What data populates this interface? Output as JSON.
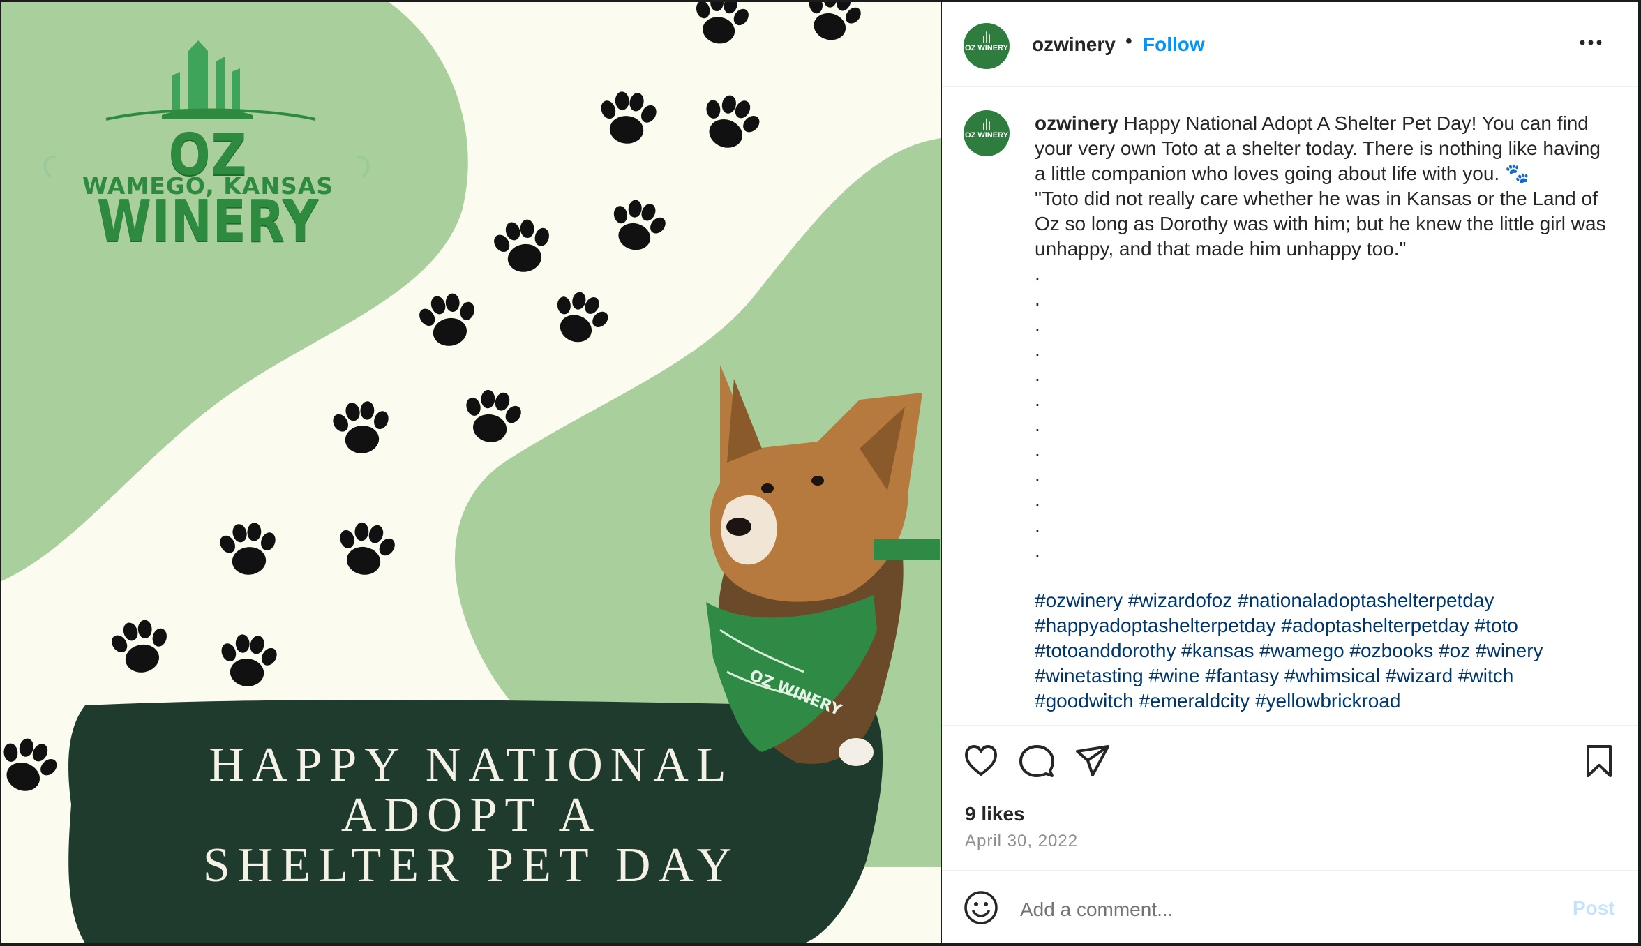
{
  "image": {
    "logo_title": "OZ WINERY",
    "logo_subtitle": "WAMEGO, KANSAS",
    "banner_lines": [
      "HAPPY NATIONAL",
      "ADOPT A",
      "SHELTER PET DAY"
    ],
    "bandana_text": "OZ WINERY"
  },
  "avatar_text": "OZ WINERY",
  "header": {
    "username": "ozwinery",
    "separator": "•",
    "follow_label": "Follow",
    "more_label": "•••"
  },
  "caption": {
    "username": "ozwinery",
    "text": " Happy National Adopt A Shelter Pet Day! You can find your very own Toto at a shelter today. There is nothing like having a little companion who loves going about life with you. 🐾\n\"Toto did not really care whether he was in Kansas or the Land of Oz so long as Dorothy was with him; but he knew the little girl was unhappy, and that made him unhappy too.\"\n.\n.\n.\n.\n.\n.\n.\n.\n.\n.\n.\n.",
    "hashtags": [
      "#ozwinery",
      "#wizardofoz",
      "#nationaladoptashelterpetday",
      "#happyadoptashelterpetday",
      "#adoptashelterpetday",
      "#toto",
      "#totoanddorothy",
      "#kansas",
      "#wamego",
      "#ozbooks",
      "#oz",
      "#winery",
      "#winetasting",
      "#wine",
      "#fantasy",
      "#whimsical",
      "#wizard",
      "#witch",
      "#goodwitch",
      "#emeraldcity",
      "#yellowbrickroad"
    ]
  },
  "actions": {
    "like_icon": "heart-icon",
    "comment_icon": "comment-bubble-icon",
    "share_icon": "paper-plane-icon",
    "save_icon": "bookmark-icon"
  },
  "likes": "9 likes",
  "date": "April 30, 2022",
  "comment": {
    "emoji_icon": "smiley-icon",
    "placeholder": "Add a comment...",
    "post_label": "Post"
  },
  "colors": {
    "brand_green": "#2e8a3e",
    "light_green": "#a9cf9c",
    "dark_green": "#1f3b2d",
    "follow_blue": "#0095f6",
    "hashtag_blue": "#00376b"
  }
}
